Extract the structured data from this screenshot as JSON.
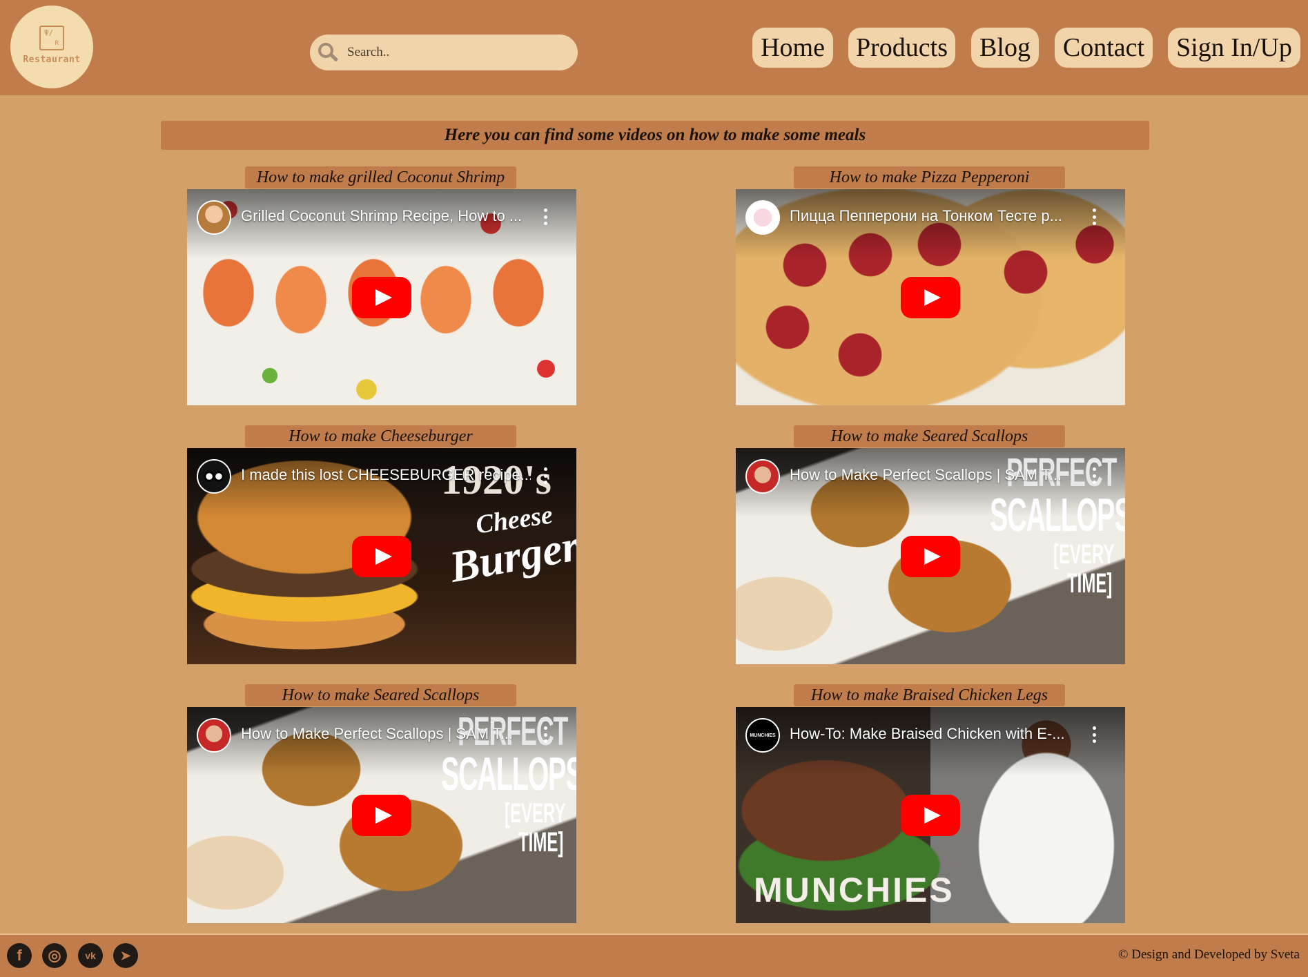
{
  "header": {
    "logo_text": "Restaurant",
    "logo_mark_a": "Ψ/",
    "logo_mark_b": "R",
    "search_placeholder": "Search..",
    "nav": [
      "Home",
      "Products",
      "Blog",
      "Contact",
      "Sign In/Up"
    ]
  },
  "banner": "Here you can find some videos on how to make some meals",
  "videos": [
    {
      "label": "How to make grilled Coconut Shrimp",
      "title": "Grilled Coconut Shrimp Recipe, How to ..."
    },
    {
      "label": "How to make Pizza Pepperoni",
      "title": "Пицца Пепперони на Тонком Тесте р..."
    },
    {
      "label": "How to make Cheeseburger",
      "title": "I made this lost CHEESEBURGER recipe...",
      "overlay": [
        "1920's",
        "Cheese",
        "Burger"
      ]
    },
    {
      "label": "How to make Seared Scallops",
      "title": "How to Make Perfect Scallops | SAM T...",
      "overlay": [
        "PERFECT",
        "SCALLOPS",
        "[EVERY",
        "TIME]"
      ]
    },
    {
      "label": "How to make Seared Scallops",
      "title": "How to Make Perfect Scallops | SAM T...",
      "overlay": [
        "PERFECT",
        "SCALLOPS",
        "[EVERY",
        "TIME]"
      ]
    },
    {
      "label": "How to make Braised Chicken Legs",
      "title": "How-To: Make Braised Chicken with E-...",
      "overlay": [
        "MUNCHIES"
      ],
      "avatar_text": "MUNCHIES"
    }
  ],
  "footer": {
    "social": [
      "facebook-icon",
      "instagram-icon",
      "vk-icon",
      "telegram-icon"
    ],
    "social_glyphs": [
      "f",
      "◎",
      "vk",
      "➤"
    ],
    "copyright": "© Design and Developed by Sveta"
  },
  "colors": {
    "page_bg": "#d4a06a",
    "header_bg": "#c07d4b",
    "pill_bg": "#f2d4ab",
    "play_red": "#ff0000"
  }
}
